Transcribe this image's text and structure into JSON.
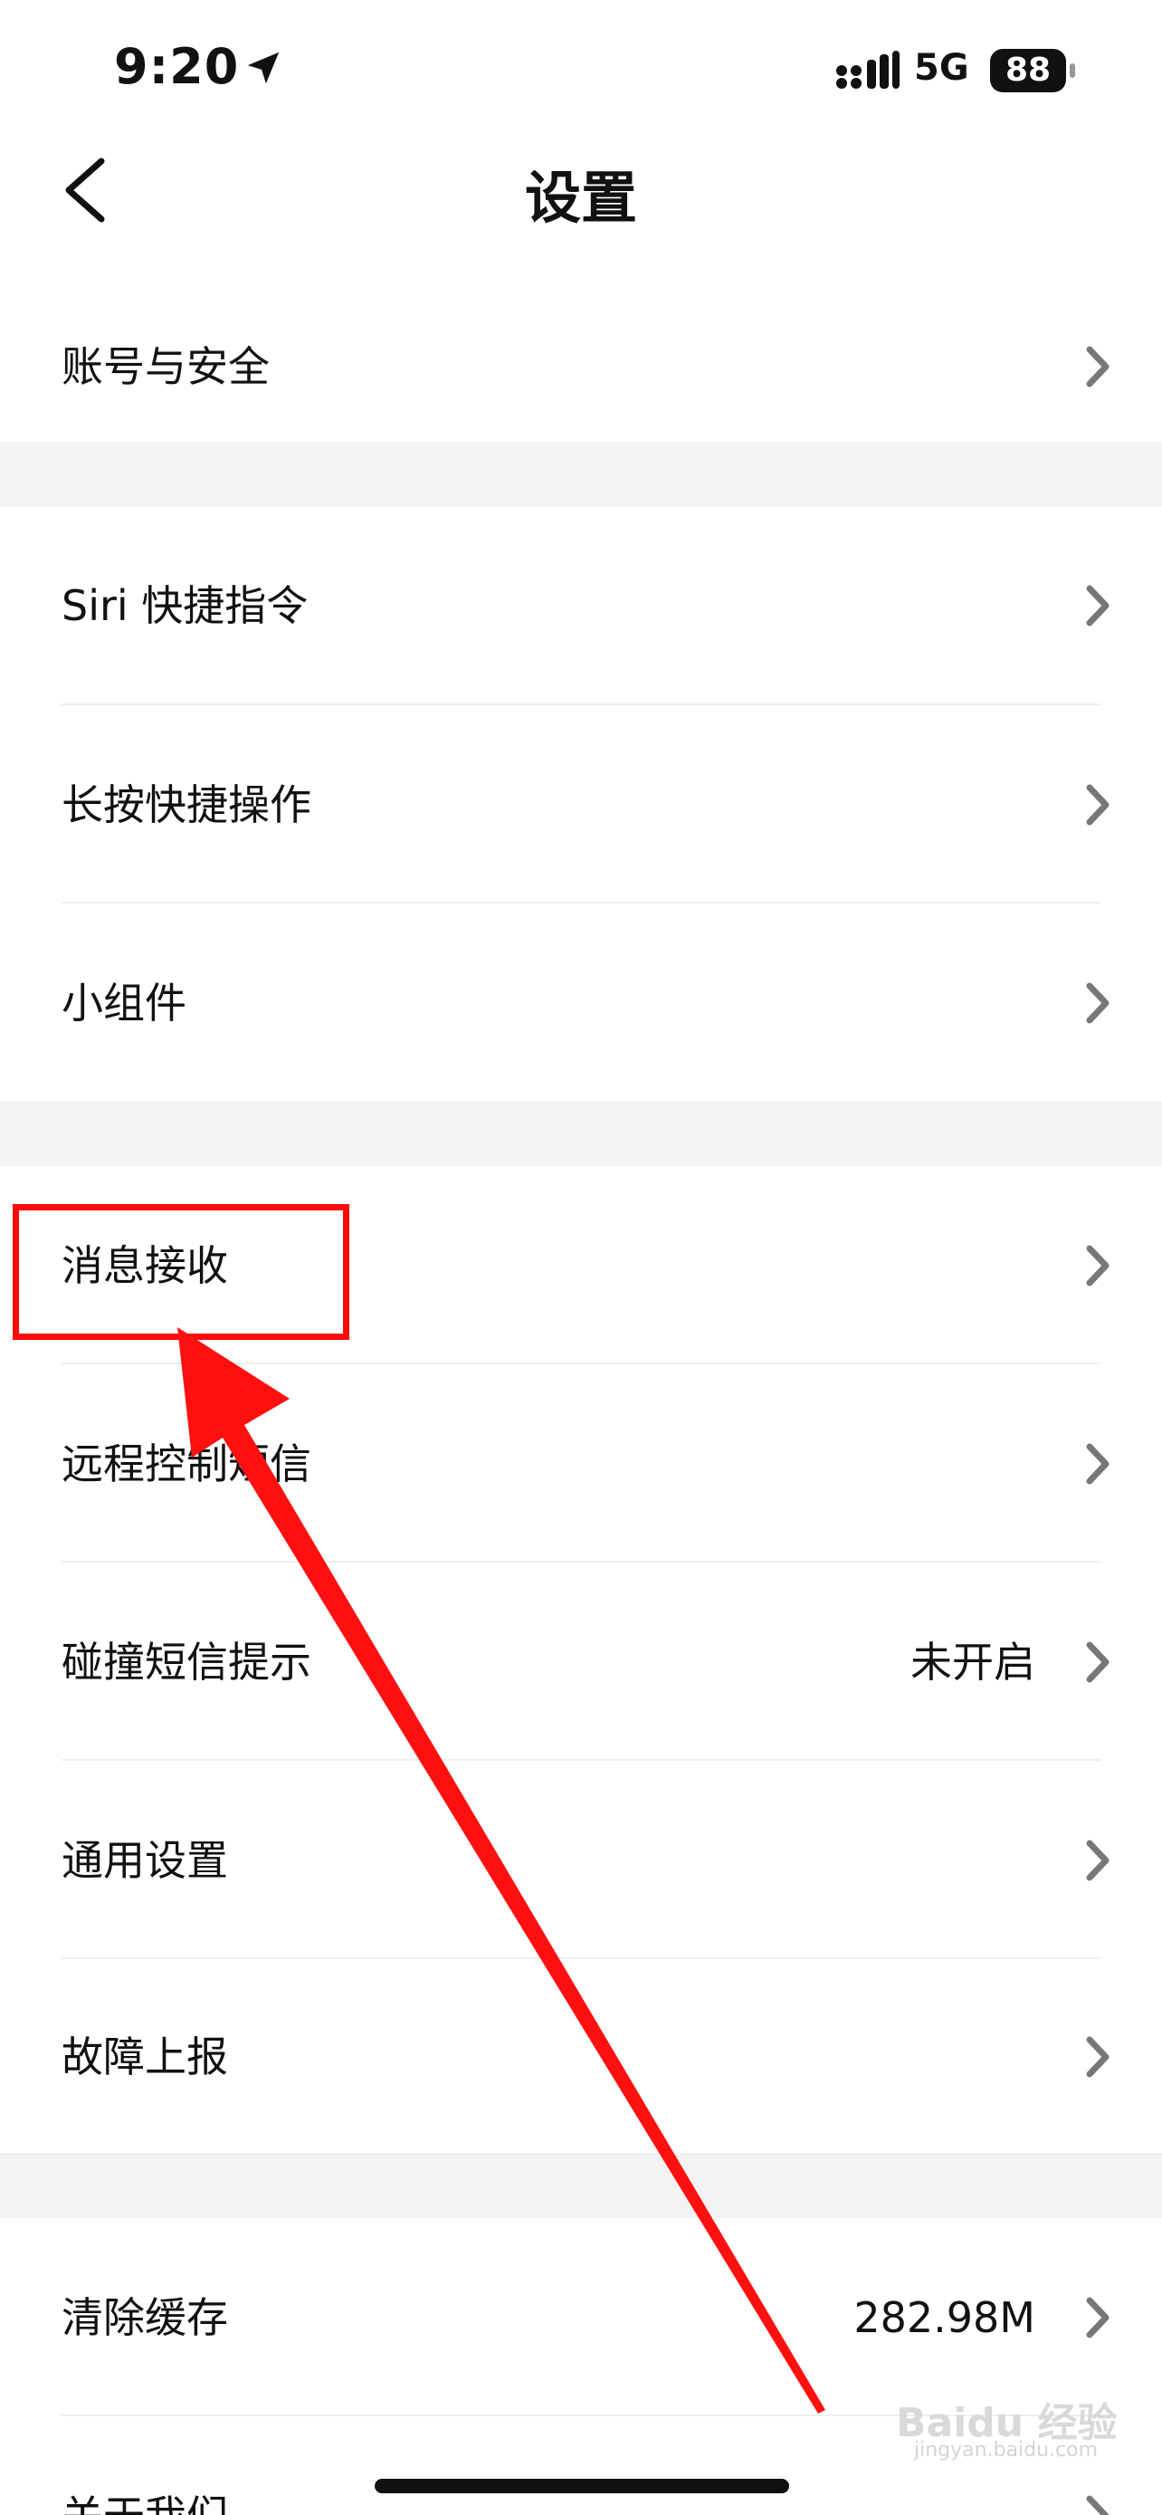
{
  "status_bar": {
    "time": "9:20",
    "network": "5G",
    "battery": "88",
    "icons": [
      "location-arrow-icon",
      "signal-icon",
      "battery-icon"
    ]
  },
  "nav": {
    "title": "设置",
    "back_icon": "chevron-left-icon"
  },
  "sections": [
    {
      "items": [
        {
          "label": "账号与安全",
          "value": ""
        }
      ]
    },
    {
      "items": [
        {
          "label": "Siri 快捷指令",
          "value": ""
        },
        {
          "label": "长按快捷操作",
          "value": ""
        },
        {
          "label": "小组件",
          "value": ""
        }
      ]
    },
    {
      "items": [
        {
          "label": "消息接收",
          "value": ""
        },
        {
          "label": "远程控制短信",
          "value": ""
        },
        {
          "label": "碰撞短信提示",
          "value": "未开启"
        },
        {
          "label": "通用设置",
          "value": ""
        },
        {
          "label": "故障上报",
          "value": ""
        }
      ]
    },
    {
      "items": [
        {
          "label": "清除缓存",
          "value": "282.98M"
        },
        {
          "label": "关于我们",
          "value": ""
        }
      ]
    }
  ],
  "watermark": {
    "text": "Baidu 经验",
    "sub": "jingyan.baidu.com"
  },
  "colors": {
    "annotation": "#ff0a0a",
    "section_gap": "#f3f3f3",
    "chevron": "#777777"
  }
}
